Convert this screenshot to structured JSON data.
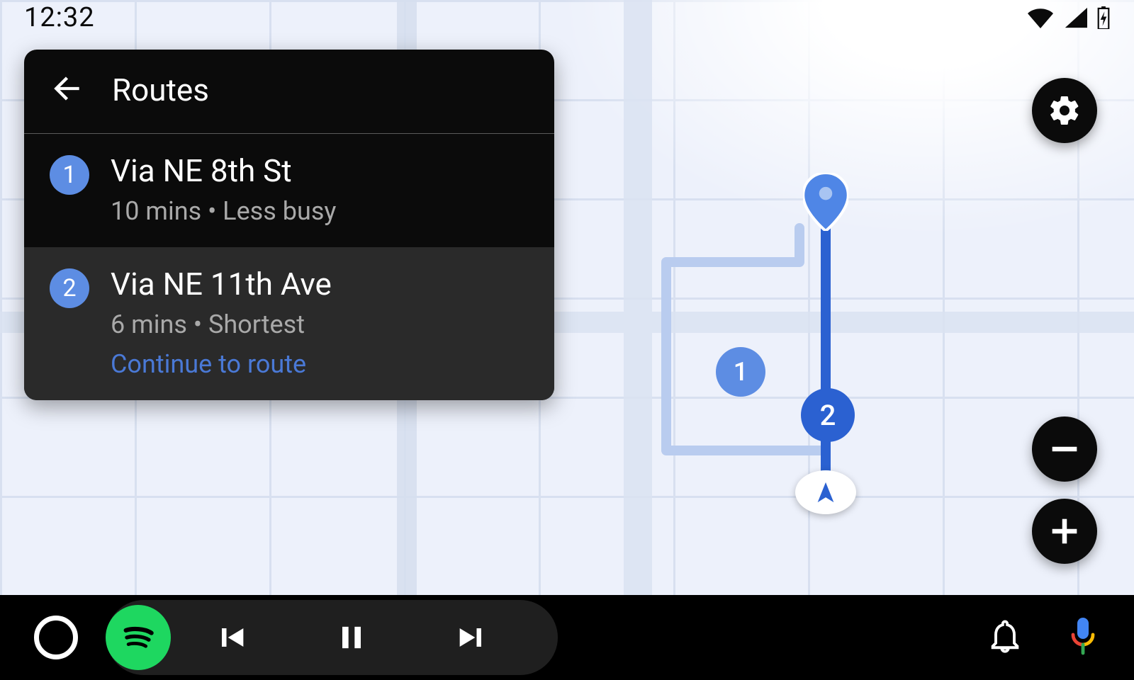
{
  "status": {
    "time": "12:32"
  },
  "panel": {
    "title": "Routes",
    "routes": [
      {
        "num": "1",
        "name": "Via NE 8th St",
        "sub": "10 mins • Less busy",
        "selected": false
      },
      {
        "num": "2",
        "name": "Via NE 11th Ave",
        "sub": "6 mins • Shortest",
        "cta": "Continue to route",
        "selected": true
      }
    ]
  },
  "map": {
    "markers": {
      "one": "1",
      "two": "2"
    }
  },
  "colors": {
    "accent": "#5d8de3",
    "accent_dark": "#2b61d1",
    "link": "#4a79d6"
  }
}
